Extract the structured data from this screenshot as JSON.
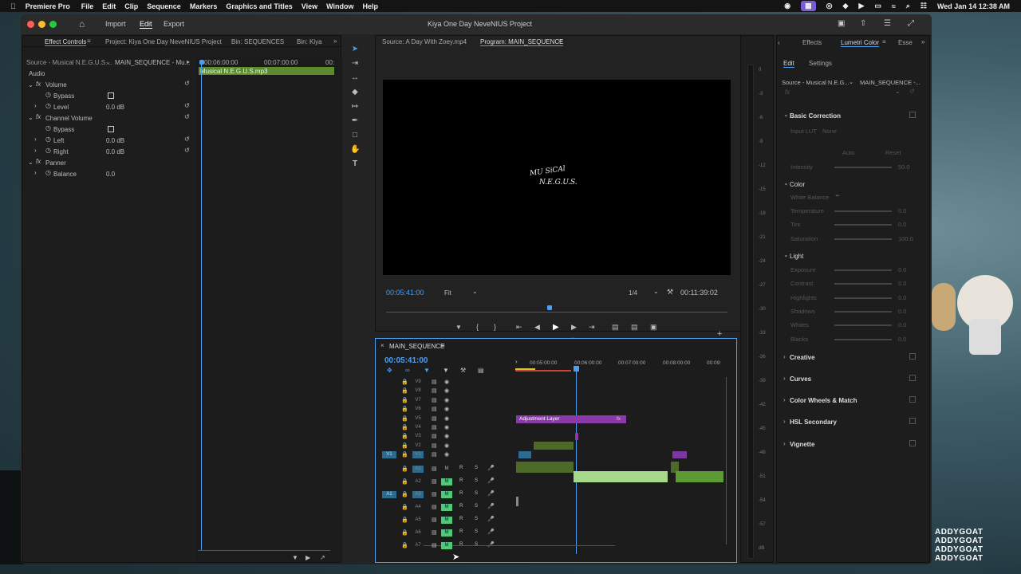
{
  "menubar": {
    "app_name": "Premiere Pro",
    "items": [
      "File",
      "Edit",
      "Clip",
      "Sequence",
      "Markers",
      "Graphics and Titles",
      "View",
      "Window",
      "Help"
    ],
    "datetime": "Wed Jan 14  12:38 AM"
  },
  "titlebar": {
    "title": "Kiya One Day NeveNIUS Project",
    "workspaces": [
      "Import",
      "Edit",
      "Export"
    ],
    "active_workspace": "Edit"
  },
  "effect_controls": {
    "tabs": [
      "Effect Controls",
      "Project: Kiya One Day NeveNIUS Project",
      "Bin: SEQUENCES",
      "Bin: Kiya"
    ],
    "source_label": "Source - Musical N.E.G.U.S....",
    "sequence_label": "MAIN_SEQUENCE - Mu...",
    "ruler": [
      "00:06:00:00",
      "00:07:00:00",
      "00:"
    ],
    "clip_name": "Musical N.E.G.U.S.mp3",
    "section": "Audio",
    "rows": [
      {
        "label": "Volume",
        "type": "fx"
      },
      {
        "label": "Bypass",
        "type": "check"
      },
      {
        "label": "Level",
        "value": "0.0 dB"
      },
      {
        "label": "Channel Volume",
        "type": "fx"
      },
      {
        "label": "Bypass",
        "type": "check"
      },
      {
        "label": "Left",
        "value": "0.0 dB"
      },
      {
        "label": "Right",
        "value": "0.0 dB"
      },
      {
        "label": "Panner",
        "type": "fx"
      },
      {
        "label": "Balance",
        "value": "0.0"
      }
    ]
  },
  "program_monitor": {
    "source_tab": "Source: A Day With Zoey.mp4",
    "program_tab": "Program: MAIN_SEQUENCE",
    "video_text_line1": "MU SiCAl",
    "video_text_line2": "N.E.G.U.S.",
    "timecode": "00:05:41:00",
    "fit": "Fit",
    "resolution": "1/4",
    "duration": "00:11:39:02"
  },
  "timeline": {
    "name": "MAIN_SEQUENCE",
    "timecode": "00:05:41:00",
    "ruler": [
      "00:05:00:00",
      "00:06:00:00",
      "00:07:00:00",
      "00:08:00:00",
      "00:09:"
    ],
    "video_tracks": [
      "V9",
      "V8",
      "V7",
      "V6",
      "V5",
      "V4",
      "V3",
      "V2",
      "V1"
    ],
    "audio_tracks": [
      "A1",
      "A2",
      "A3",
      "A4",
      "A5",
      "A6",
      "A7"
    ],
    "source_patch_v": "V1",
    "source_patch_a": "A1",
    "adjustment_label": "Adjustment Layer",
    "m_label": "M",
    "r_label": "R",
    "s_label": "S"
  },
  "lumetri": {
    "tabs": [
      "Effects",
      "Lumetri Color",
      "Esse"
    ],
    "subtabs": [
      "Edit",
      "Settings"
    ],
    "source_label": "Source - Musical N.E.G...",
    "sequence_label": "MAIN_SEQUENCE -...",
    "sections": [
      "Basic Correction",
      "Creative",
      "Curves",
      "Color Wheels & Match",
      "HSL Secondary",
      "Vignette"
    ],
    "input_lut_label": "Input LUT",
    "input_lut_value": "None",
    "auto": "Auto",
    "reset": "Reset",
    "intensity_label": "Intensity",
    "intensity_value": "50.0",
    "color_group": "Color",
    "white_balance": "White Balance",
    "color_sliders": [
      {
        "label": "Temperature",
        "value": "0.0"
      },
      {
        "label": "Tint",
        "value": "0.0"
      },
      {
        "label": "Saturation",
        "value": "100.0"
      }
    ],
    "light_group": "Light",
    "light_sliders": [
      {
        "label": "Exposure",
        "value": "0.0"
      },
      {
        "label": "Contrast",
        "value": "0.0"
      },
      {
        "label": "Highlights",
        "value": "0.0"
      },
      {
        "label": "Shadows",
        "value": "0.0"
      },
      {
        "label": "Whites",
        "value": "0.0"
      },
      {
        "label": "Blacks",
        "value": "0.0"
      }
    ]
  },
  "meter_scale": [
    "0",
    "-3",
    "-6",
    "-9",
    "-12",
    "-15",
    "-18",
    "-21",
    "-24",
    "-27",
    "-30",
    "-33",
    "-36",
    "-39",
    "-42",
    "-45",
    "-48",
    "-51",
    "-54",
    "-57",
    "dB"
  ],
  "watermark": [
    "ADDYGOAT",
    "ADDYGOAT",
    "ADDYGOAT",
    "ADDYGOAT"
  ],
  "colors": {
    "accent": "#4a9ff5",
    "audio_clip": "#5d8a2e",
    "adjustment": "#8a3aa8",
    "light_green": "#a6d98a"
  }
}
